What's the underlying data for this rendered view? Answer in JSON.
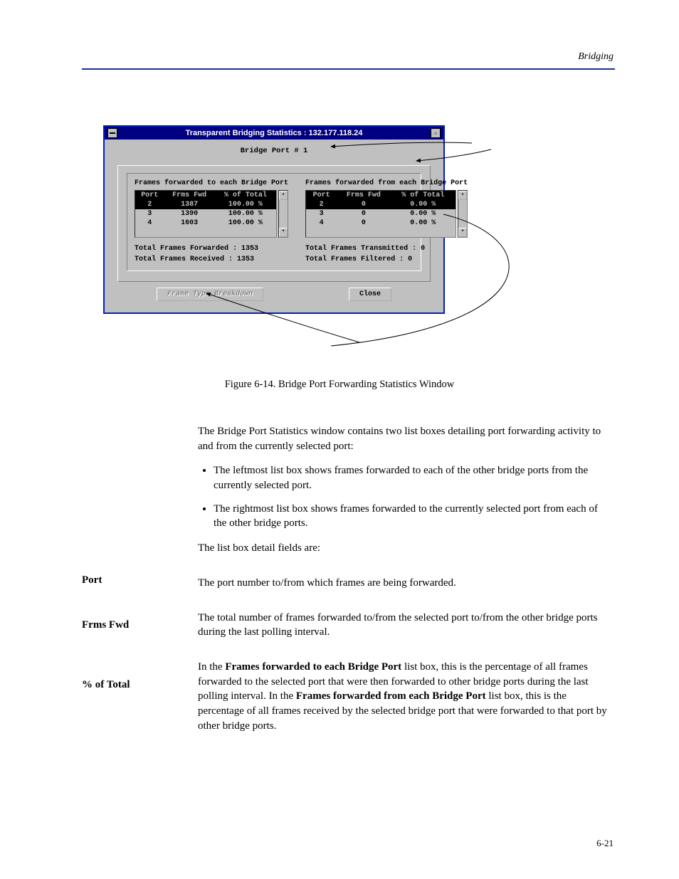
{
  "header": {
    "right_text": "Bridging",
    "page_number": "6-21"
  },
  "figure": {
    "caption": "Figure 6-14.  Bridge Port Forwarding Statistics Window",
    "window": {
      "title": "Transparent Bridging Statistics : 132.177.118.24",
      "bridge_port_label": "Bridge Port # 1",
      "left_panel_title": "Frames forwarded to each Bridge Port",
      "right_panel_title": "Frames forwarded from each Bridge Port",
      "col_port": "Port",
      "col_frms": "Frms Fwd",
      "col_pct": "% of Total",
      "left_rows": [
        {
          "port": "2",
          "frms": "1387",
          "pct": "100.00 %",
          "selected": true
        },
        {
          "port": "3",
          "frms": "1390",
          "pct": "100.00 %",
          "selected": false
        },
        {
          "port": "4",
          "frms": "1603",
          "pct": "100.00 %",
          "selected": false
        }
      ],
      "right_rows": [
        {
          "port": "2",
          "frms": "0",
          "pct": "0.00 %",
          "selected": true
        },
        {
          "port": "3",
          "frms": "0",
          "pct": "0.00 %",
          "selected": false
        },
        {
          "port": "4",
          "frms": "0",
          "pct": "0.00 %",
          "selected": false
        }
      ],
      "left_totals": {
        "forwarded_label": "Total Frames Forwarded :",
        "forwarded_value": "1353",
        "received_label": "Total Frames Received  :",
        "received_value": "1353"
      },
      "right_totals": {
        "transmitted_label": "Total Frames Transmitted :",
        "transmitted_value": "0",
        "filtered_label": "Total Frames Filtered    :",
        "filtered_value": "0"
      },
      "button_breakdown": "Frame Type Breakdown",
      "button_close": "Close"
    }
  },
  "body": {
    "intro": "The Bridge Port Statistics window contains two list boxes detailing port forwarding activity to and from the currently selected port:",
    "bullets": [
      "The leftmost list box shows frames forwarded to each of the other bridge ports from the currently selected port.",
      "The rightmost list box shows frames forwarded to the currently selected port from each of the other bridge ports."
    ],
    "fields_intro": "The list box detail fields are:",
    "port_label": "Port",
    "port_text": "The port number to/from which frames are being forwarded.",
    "frms_label": "Frms Fwd",
    "frms_text": "The total number of frames forwarded to/from the selected port to/from the other bridge ports during the last polling interval.",
    "pct_label": "% of Total",
    "pct_text_1": "In the ",
    "pct_bold_1": "Frames forwarded to each Bridge Port",
    "pct_text_2": " list box, this is the percentage of all frames forwarded to the selected port that were then forwarded to other bridge ports during the last polling interval. In the ",
    "pct_bold_2": "Frames forwarded from each Bridge Port",
    "pct_text_3": " list box, this is the percentage of all frames received by the selected bridge port that were forwarded to that port by other bridge ports."
  }
}
